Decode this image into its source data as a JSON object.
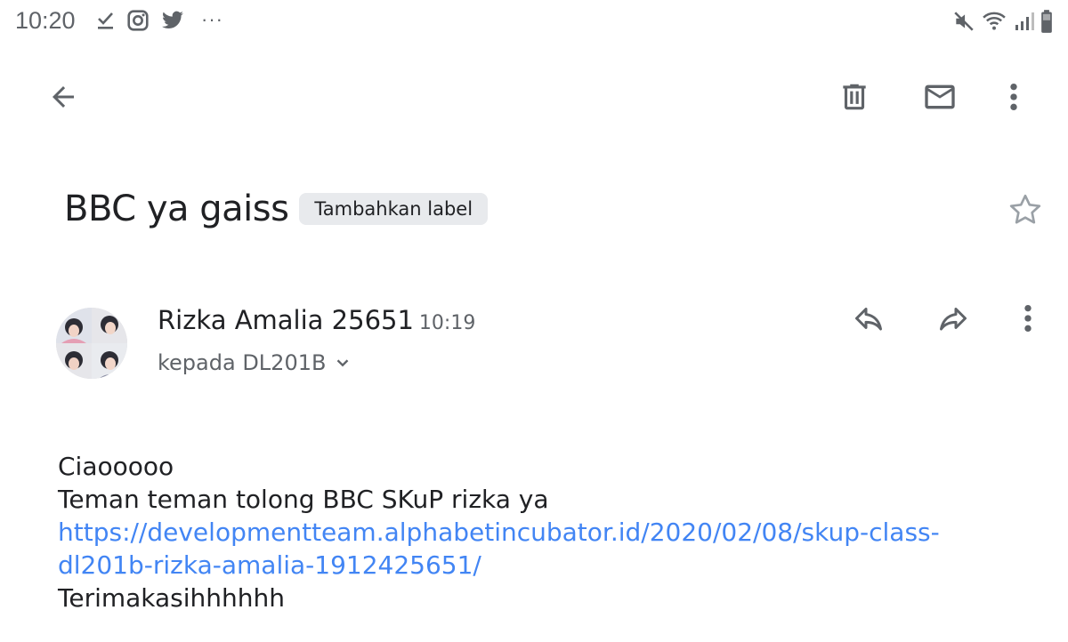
{
  "status_bar": {
    "time": "10:20",
    "left_icons": [
      "checkbox-download-icon",
      "instagram-icon",
      "twitter-icon"
    ],
    "more": "···",
    "right_icons": [
      "mute-icon",
      "wifi-icon",
      "signal-icon",
      "battery-icon"
    ]
  },
  "toolbar": {
    "back_icon": "arrow-back-icon",
    "delete_icon": "trash-icon",
    "mark_unread_icon": "mail-icon",
    "more_icon": "more-vert-icon"
  },
  "email": {
    "subject": "BBC ya gaiss",
    "label_chip": "Tambahkan label",
    "star_icon": "star-outline-icon",
    "sender_name": "Rizka Amalia 25651",
    "time": "10:19",
    "recipient": "kepada DL201B",
    "body": {
      "line1": "Ciaooooo",
      "line2": "Teman teman tolong BBC SKuP rizka ya",
      "link_part1": "https://developmentteam.alphabetincubator.id/2020/02/08/skup-class-",
      "link_part2": "dl201b-rizka-amalia-1912425651/",
      "line4": "Terimakasihhhhhh"
    }
  },
  "colors": {
    "link": "#4285f4",
    "icon": "#5f6368",
    "chip_bg": "#e8eaed"
  }
}
